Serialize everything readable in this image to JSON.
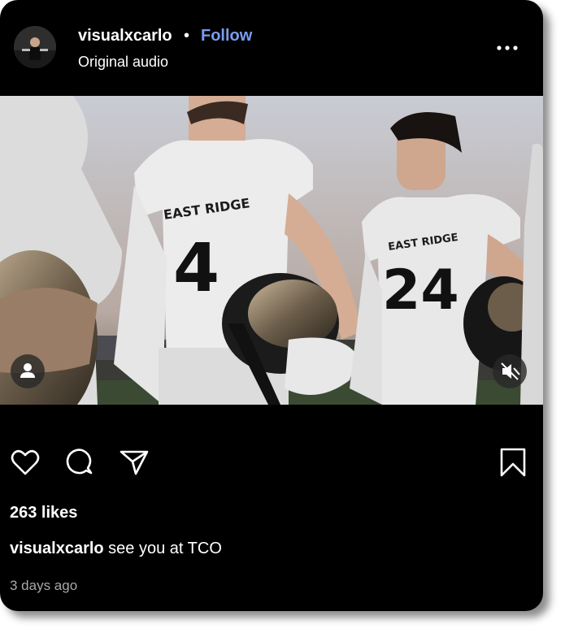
{
  "post": {
    "username": "visualxcarlo",
    "separator": "•",
    "follow_label": "Follow",
    "audio_label": "Original audio",
    "likes_text": "263 likes",
    "caption_user": "visualxcarlo",
    "caption_text": " see you at TCO",
    "timestamp": "3 days ago"
  },
  "media": {
    "jersey_text_left": "EAST RIDGE",
    "jersey_number_left": "4",
    "jersey_text_right": "EAST RIDGE",
    "jersey_number_right": "24"
  },
  "icons": {
    "more": "more-horizontal-icon",
    "tag": "user-tag-icon",
    "mute": "speaker-muted-icon",
    "like": "heart-icon",
    "comment": "comment-bubble-icon",
    "share": "paper-plane-icon",
    "save": "bookmark-icon"
  },
  "colors": {
    "background": "#000000",
    "follow": "#7a9cf0",
    "timestamp": "#a8a8a8"
  }
}
